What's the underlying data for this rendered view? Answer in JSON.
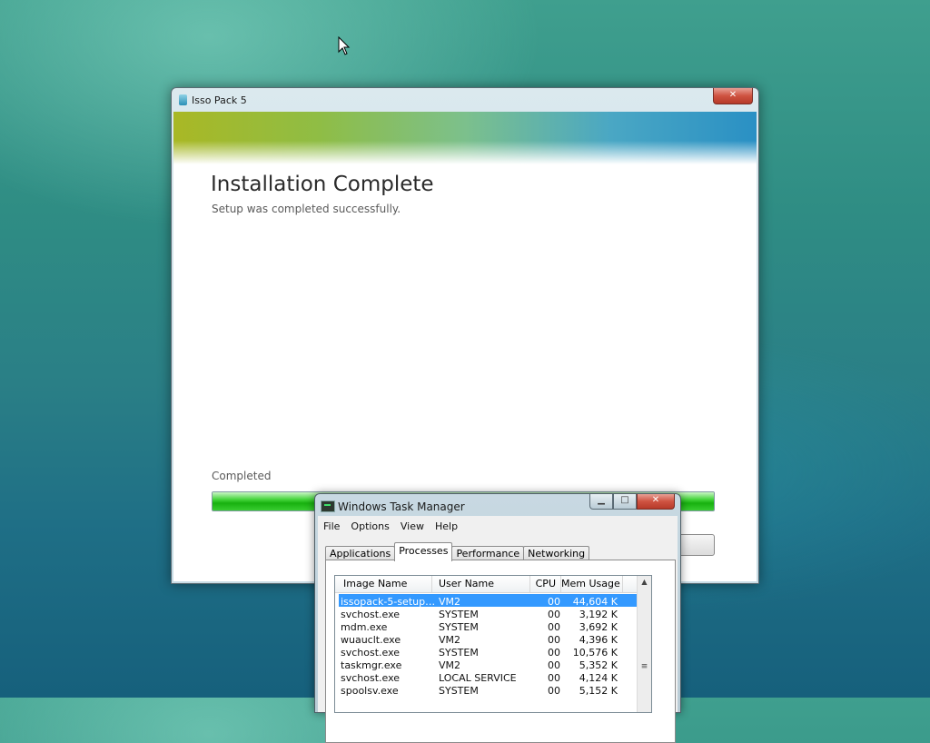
{
  "installer": {
    "window_title": "Isso Pack 5",
    "heading": "Installation Complete",
    "subheading": "Setup was completed successfully.",
    "status_label": "Completed",
    "progress_fraction": 1.0,
    "colors": {
      "progress_green": "#17b10f",
      "close_red": "#cf5341"
    }
  },
  "taskmanager": {
    "title": "Windows Task Manager",
    "menu": [
      "File",
      "Options",
      "View",
      "Help"
    ],
    "tabs": [
      "Applications",
      "Processes",
      "Performance",
      "Networking"
    ],
    "active_tab": "Processes",
    "columns": [
      "Image Name",
      "User Name",
      "CPU",
      "Mem Usage"
    ],
    "rows": [
      [
        "issopack-5-setup....",
        "VM2",
        "00",
        "44,604 K"
      ],
      [
        "svchost.exe",
        "SYSTEM",
        "00",
        "3,192 K"
      ],
      [
        "mdm.exe",
        "SYSTEM",
        "00",
        "3,692 K"
      ],
      [
        "wuauclt.exe",
        "VM2",
        "00",
        "4,396 K"
      ],
      [
        "svchost.exe",
        "SYSTEM",
        "00",
        "10,576 K"
      ],
      [
        "taskmgr.exe",
        "VM2",
        "00",
        "5,352 K"
      ],
      [
        "svchost.exe",
        "LOCAL SERVICE",
        "00",
        "4,124 K"
      ],
      [
        "spoolsv.exe",
        "SYSTEM",
        "00",
        "5,152 K"
      ]
    ],
    "selected_row": 0
  }
}
